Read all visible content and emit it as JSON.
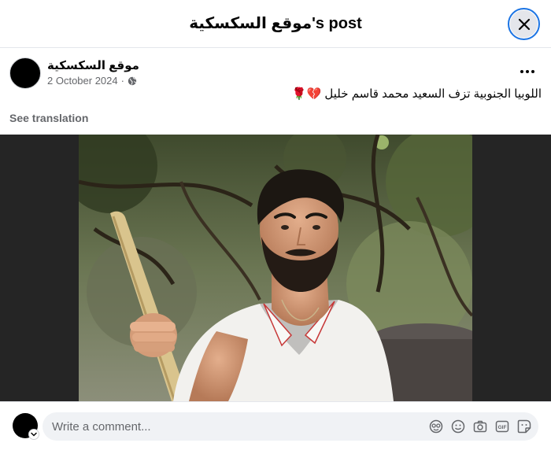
{
  "dialog": {
    "title": "موقع السكسكية's post"
  },
  "post": {
    "author": "موقع السكسكية",
    "date": "2 October 2024",
    "separator": "·",
    "privacy_icon": "globe-icon",
    "caption": "اللوبيا الجنوبية تزف السعيد محمد قاسم خليل 💔🌹",
    "see_translation": "See translation"
  },
  "composer": {
    "placeholder": "Write a comment...",
    "icons": [
      "avatar-sticker-icon",
      "emoji-icon",
      "camera-icon",
      "gif-icon",
      "sticker-icon"
    ]
  },
  "colors": {
    "accent": "#1b74e4",
    "secondary_text": "#65676b",
    "input_bg": "#f0f2f5",
    "media_bg": "#252525"
  }
}
